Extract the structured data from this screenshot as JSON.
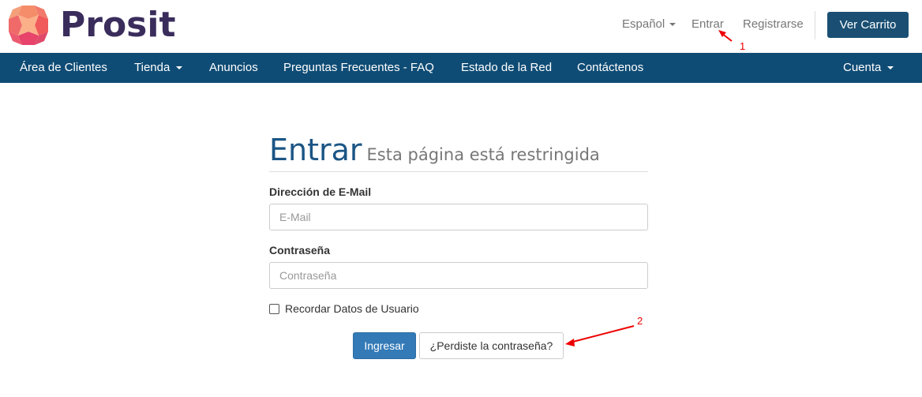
{
  "brand": {
    "name": "Prosit",
    "colors": {
      "mark": [
        "#f15a5a",
        "#f58c6a",
        "#e7436b"
      ],
      "text": "#3a2d5c"
    }
  },
  "header": {
    "language": "Español",
    "login": "Entrar",
    "register": "Registrarse",
    "cart": "Ver Carrito"
  },
  "nav": {
    "items": [
      "Área de Clientes",
      "Tienda",
      "Anuncios",
      "Preguntas Frecuentes - FAQ",
      "Estado de la Red",
      "Contáctenos"
    ],
    "account": "Cuenta"
  },
  "form": {
    "title": "Entrar",
    "subtitle": "Esta página está restringida",
    "email_label": "Dirección de E-Mail",
    "email_placeholder": "E-Mail",
    "password_label": "Contraseña",
    "password_placeholder": "Contraseña",
    "remember_label": "Recordar Datos de Usuario",
    "submit": "Ingresar",
    "forgot": "¿Perdiste la contraseña?"
  },
  "annotations": {
    "one": "1",
    "two": "2",
    "color": "#e00000"
  }
}
